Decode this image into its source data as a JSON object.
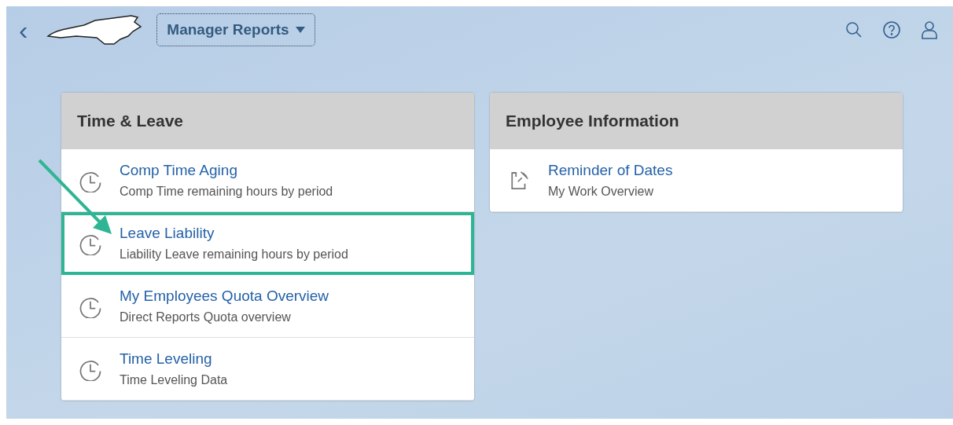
{
  "header": {
    "back": "‹",
    "menu_title": "Manager Reports"
  },
  "groups": [
    {
      "title": "Time & Leave",
      "items": [
        {
          "kind": "clock",
          "title": "Comp Time Aging",
          "subtitle": "Comp Time remaining hours by period",
          "highlighted": false
        },
        {
          "kind": "clock",
          "title": "Leave Liability",
          "subtitle": "Liability Leave remaining hours by period",
          "highlighted": true
        },
        {
          "kind": "clock",
          "title": "My Employees Quota Overview",
          "subtitle": "Direct Reports Quota overview",
          "highlighted": false
        },
        {
          "kind": "clock",
          "title": "Time Leveling",
          "subtitle": "Time Leveling Data",
          "highlighted": false
        }
      ]
    },
    {
      "title": "Employee Information",
      "items": [
        {
          "kind": "pin-note",
          "title": "Reminder of Dates",
          "subtitle": "My Work Overview",
          "highlighted": false
        }
      ]
    }
  ]
}
